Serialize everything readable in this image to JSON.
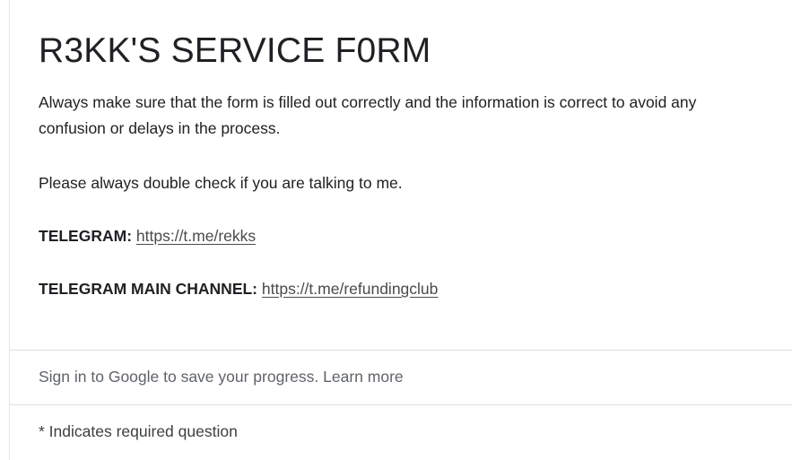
{
  "form": {
    "title": "R3KK'S SERVICE F0RM",
    "description": {
      "intro": "Always make sure that the form is filled out correctly and the information is correct to avoid any confusion or delays in the process.",
      "check": "Please always double check if you are talking to me.",
      "telegram_label": "TELEGRAM:",
      "telegram_link": "https://t.me/rekks",
      "channel_label": "TELEGRAM MAIN CHANNEL:",
      "channel_link": "https://t.me/refundingclub"
    },
    "signin_text": "Sign in to Google to save your progress.",
    "learn_more": "Learn more",
    "required_note": "* Indicates required question"
  },
  "colors": {
    "text": "#202124",
    "muted": "#5f6368",
    "divider": "#e0e0e0"
  }
}
